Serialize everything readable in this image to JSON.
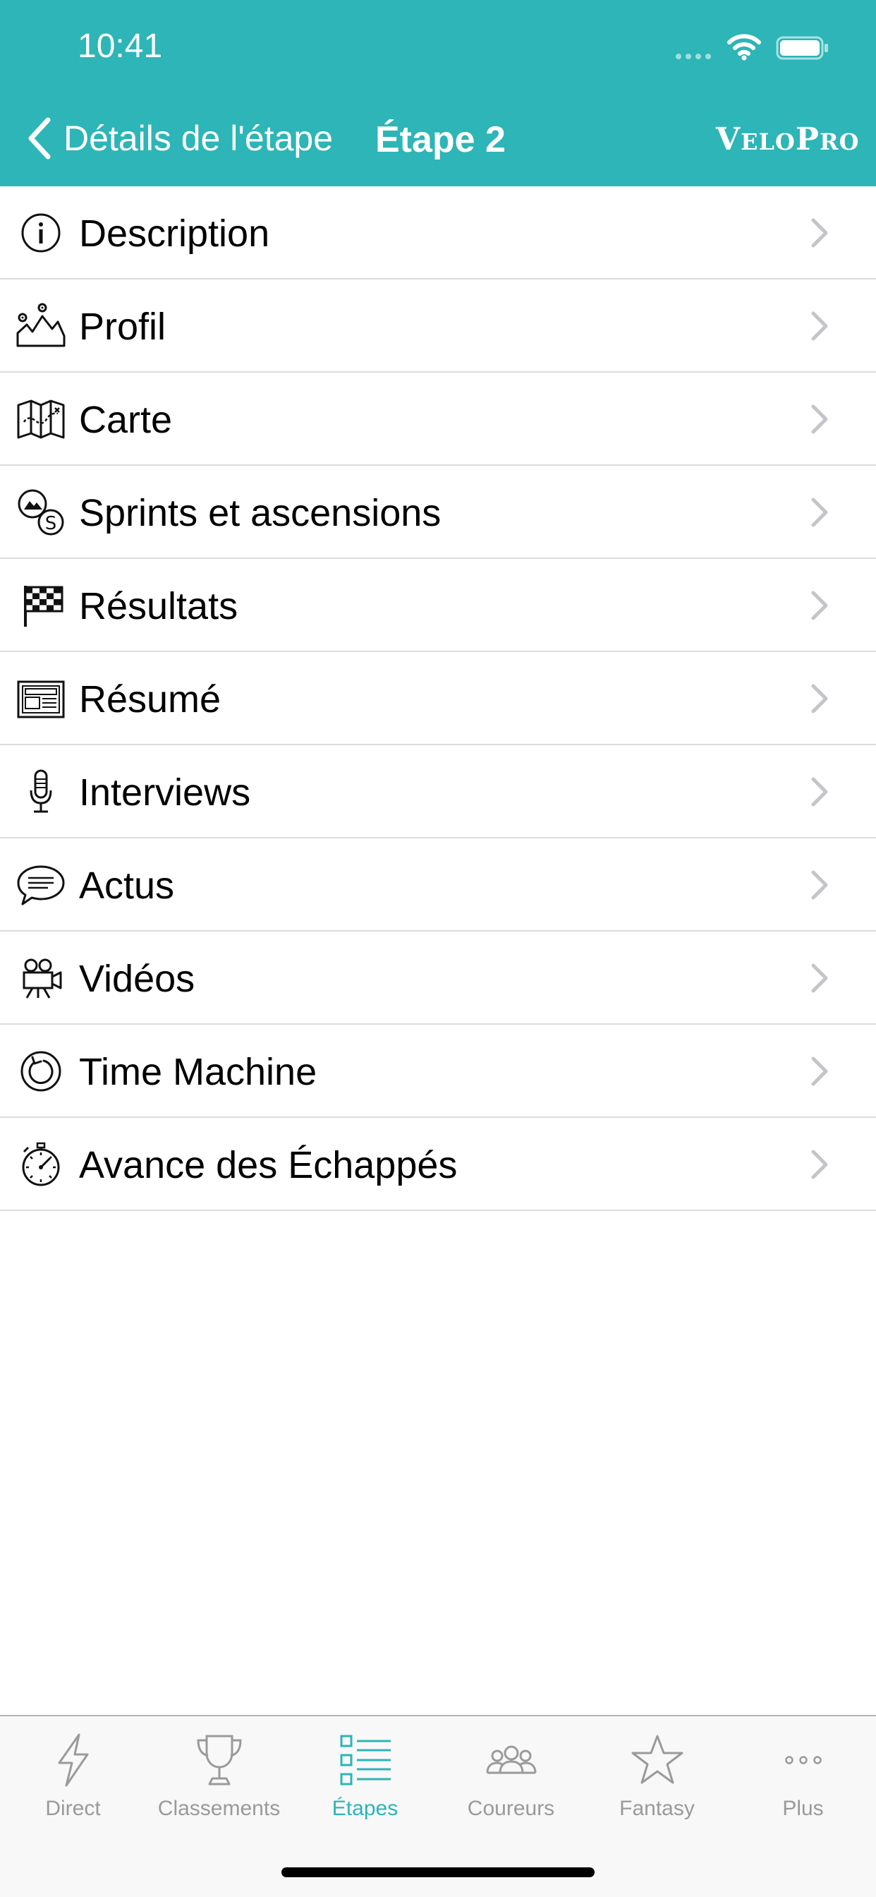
{
  "status_bar": {
    "time": "10:41"
  },
  "nav": {
    "back_label": "Détails de l'étape",
    "title": "Étape 2",
    "brand_first": "V",
    "brand_small": "ELO",
    "brand_second": "P",
    "brand_small2": "RO"
  },
  "colors": {
    "accent": "#2db5b7",
    "tab_inactive": "#9a9a9a",
    "separator": "#dcdcdc"
  },
  "menu": {
    "items": [
      {
        "label": "Description",
        "icon": "info-icon"
      },
      {
        "label": "Profil",
        "icon": "profile-icon"
      },
      {
        "label": "Carte",
        "icon": "map-icon"
      },
      {
        "label": "Sprints et ascensions",
        "icon": "sprints-icon"
      },
      {
        "label": "Résultats",
        "icon": "checkered-flag-icon"
      },
      {
        "label": "Résumé",
        "icon": "newspaper-icon"
      },
      {
        "label": "Interviews",
        "icon": "microphone-icon"
      },
      {
        "label": "Actus",
        "icon": "speech-bubble-icon"
      },
      {
        "label": "Vidéos",
        "icon": "video-camera-icon"
      },
      {
        "label": "Time Machine",
        "icon": "replay-icon"
      },
      {
        "label": "Avance des Échappés",
        "icon": "stopwatch-icon"
      }
    ]
  },
  "tabbar": {
    "tabs": [
      {
        "label": "Direct",
        "icon": "lightning-icon",
        "active": false
      },
      {
        "label": "Classements",
        "icon": "trophy-icon",
        "active": false
      },
      {
        "label": "Étapes",
        "icon": "list-icon",
        "active": true
      },
      {
        "label": "Coureurs",
        "icon": "riders-icon",
        "active": false
      },
      {
        "label": "Fantasy",
        "icon": "star-icon",
        "active": false
      },
      {
        "label": "Plus",
        "icon": "more-icon",
        "active": false
      }
    ]
  }
}
